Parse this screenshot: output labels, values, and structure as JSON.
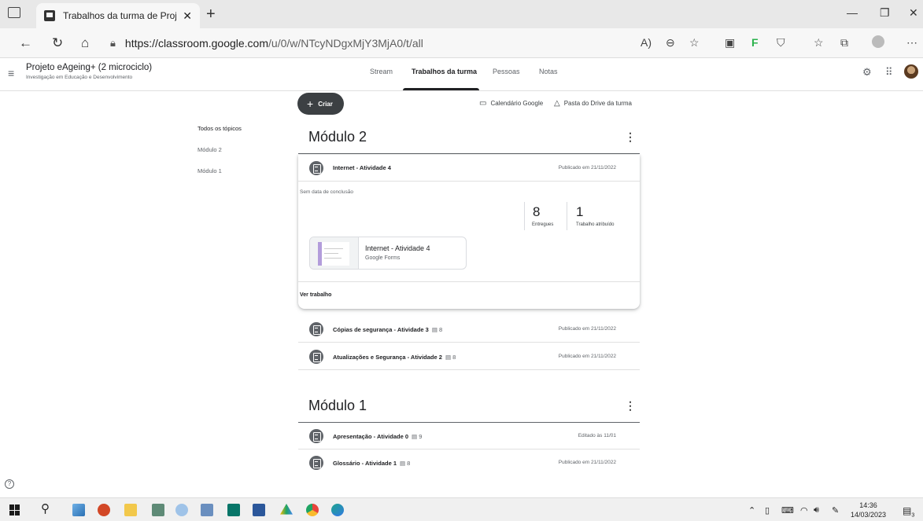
{
  "browser": {
    "tab_title": "Trabalhos da turma de Projeto e/",
    "tab_close": "✕",
    "new_tab": "+",
    "url_host": "https://classroom.google.com",
    "url_path": "/u/0/w/NTcyNDgxMjY3MjA0/t/all",
    "window_controls": [
      "minimize-icon",
      "restore-icon",
      "close-icon"
    ],
    "icons": [
      "back-icon",
      "refresh-icon",
      "home-icon",
      "lock-icon",
      "read-aloud-icon",
      "zoom-out-icon",
      "favorite-add-icon",
      "extensions-icon",
      "feedly-icon",
      "shield-icon",
      "favorites-icon",
      "collections-icon",
      "profile-icon",
      "more-icon"
    ]
  },
  "header": {
    "class_name": "Projeto eAgeing+ (2 microciclo)",
    "class_subtitle": "Investigação em Educação e Desenvolvimento",
    "tabs": [
      {
        "label": "Stream"
      },
      {
        "label": "Trabalhos da turma",
        "active": true
      },
      {
        "label": "Pessoas"
      },
      {
        "label": "Notas"
      }
    ]
  },
  "toolbar": {
    "create_label": "Criar",
    "calendar_label": "Calendário Google",
    "drive_label": "Pasta do Drive da turma"
  },
  "topics": {
    "all_label": "Todos os tópicos",
    "items": [
      "Módulo 2",
      "Módulo 1"
    ]
  },
  "modules": [
    {
      "title": "Módulo 2",
      "expanded": {
        "title": "Internet - Atividade 4",
        "date": "Publicado em 21/11/2022",
        "due": "Sem data de conclusão",
        "turned_in_count": "8",
        "turned_in_label": "Entregues",
        "assigned_count": "1",
        "assigned_label": "Trabalho atribuído",
        "attachment_title": "Internet - Atividade 4",
        "attachment_type": "Google Forms",
        "view_label": "Ver trabalho"
      },
      "items": [
        {
          "title": "Cópias de segurança - Atividade 3",
          "comments": "8",
          "date": "Publicado em 21/11/2022"
        },
        {
          "title": "Atualizações e Segurança - Atividade 2",
          "comments": "8",
          "date": "Publicado em 21/11/2022"
        }
      ]
    },
    {
      "title": "Módulo 1",
      "items": [
        {
          "title": "Apresentação - Atividade 0",
          "comments": "9",
          "date": "Editado às 11/01"
        },
        {
          "title": "Glossário - Atividade 1",
          "comments": "8",
          "date": "Publicado em 21/11/2022"
        }
      ]
    }
  ],
  "taskbar": {
    "time": "14:36",
    "date": "14/03/2023",
    "notifications": "3",
    "colors": {
      "powerpoint": "#d24726",
      "explorer": "#f2c84b",
      "publisher": "#077568",
      "word": "#2b579a",
      "drive": "#1fa463",
      "chrome": "#e8453c",
      "edge": "#1ea38f"
    }
  }
}
